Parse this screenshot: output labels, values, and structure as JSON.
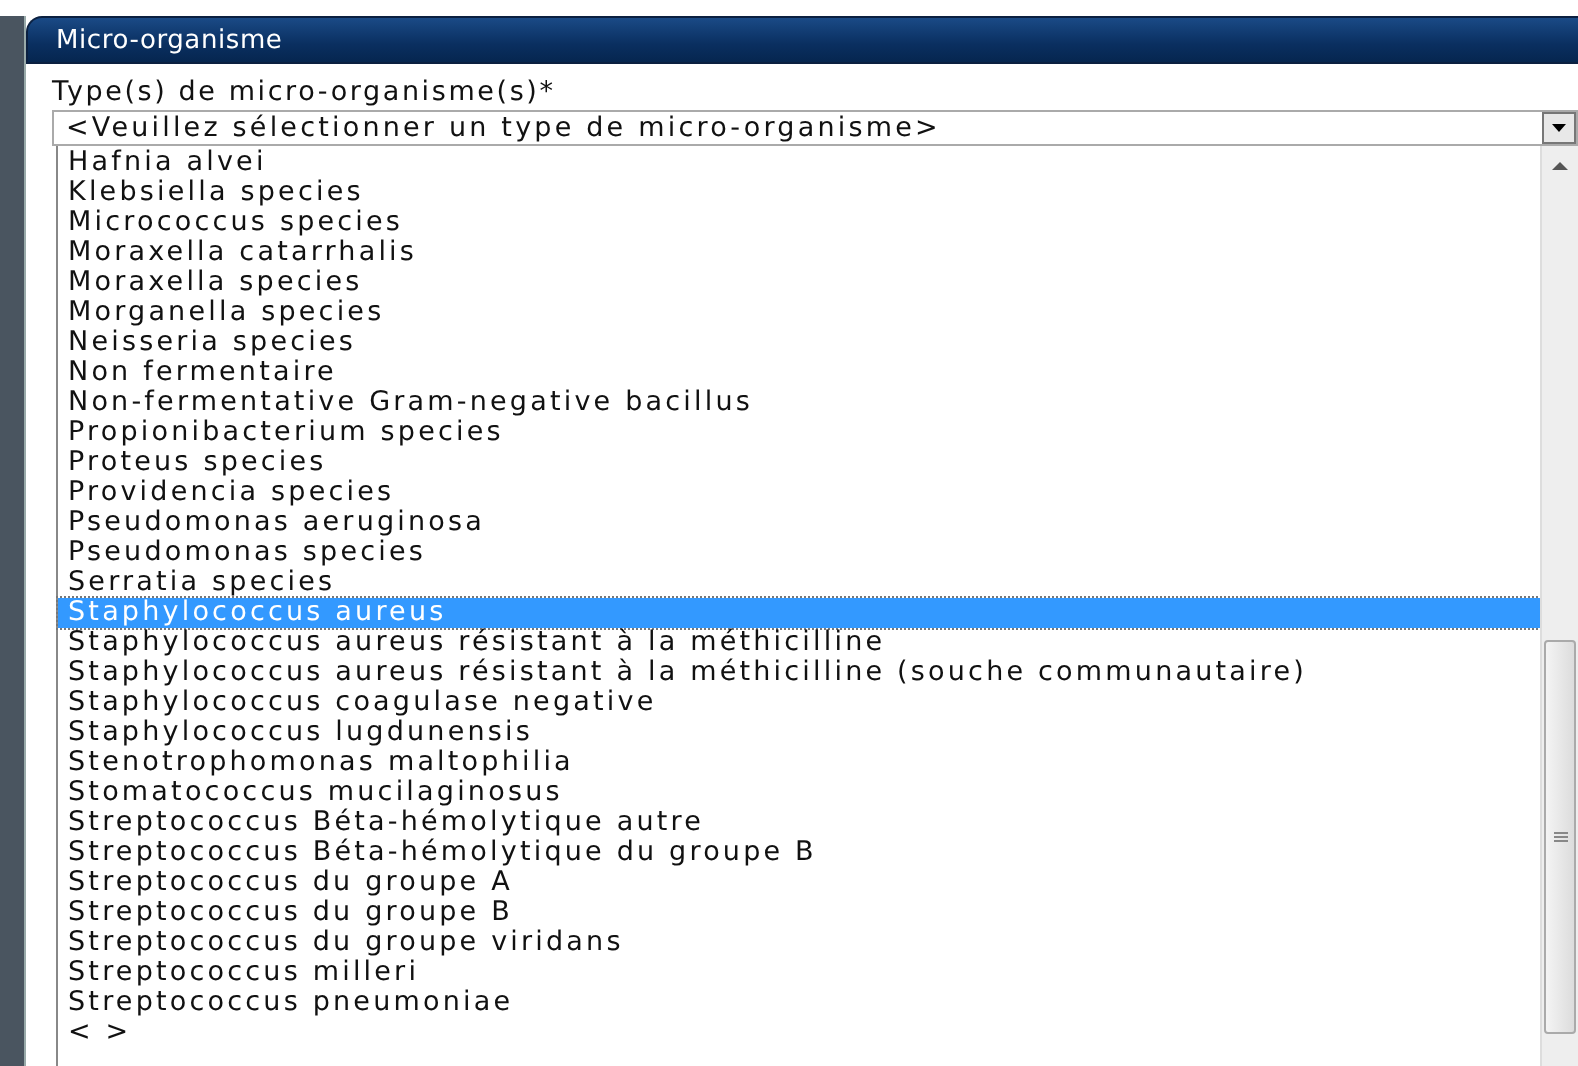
{
  "window": {
    "title": "Micro-organisme"
  },
  "field": {
    "label": "Type(s) de micro-organisme(s)*",
    "value": "<Veuillez sélectionner un type de micro-organisme>"
  },
  "options": [
    {
      "label": "Hafnia alvei",
      "selected": false
    },
    {
      "label": "Klebsiella species",
      "selected": false
    },
    {
      "label": "Micrococcus species",
      "selected": false
    },
    {
      "label": "Moraxella catarrhalis",
      "selected": false
    },
    {
      "label": "Moraxella species",
      "selected": false
    },
    {
      "label": "Morganella species",
      "selected": false
    },
    {
      "label": "Neisseria species",
      "selected": false
    },
    {
      "label": "Non fermentaire",
      "selected": false
    },
    {
      "label": "Non-fermentative Gram-negative bacillus",
      "selected": false
    },
    {
      "label": "Propionibacterium species",
      "selected": false
    },
    {
      "label": "Proteus species",
      "selected": false
    },
    {
      "label": "Providencia species",
      "selected": false
    },
    {
      "label": "Pseudomonas aeruginosa",
      "selected": false
    },
    {
      "label": "Pseudomonas species",
      "selected": false
    },
    {
      "label": "Serratia species",
      "selected": false
    },
    {
      "label": "Staphylococcus aureus",
      "selected": true
    },
    {
      "label": "Staphylococcus aureus résistant à la méthicilline",
      "selected": false
    },
    {
      "label": "Staphylococcus aureus résistant à la méthicilline (souche communautaire)",
      "selected": false
    },
    {
      "label": "Staphylococcus coagulase negative",
      "selected": false
    },
    {
      "label": "Staphylococcus lugdunensis",
      "selected": false
    },
    {
      "label": "Stenotrophomonas maltophilia",
      "selected": false
    },
    {
      "label": "Stomatococcus mucilaginosus",
      "selected": false
    },
    {
      "label": "Streptococcus Béta-hémolytique autre",
      "selected": false
    },
    {
      "label": "Streptococcus Béta-hémolytique du groupe B",
      "selected": false
    },
    {
      "label": "Streptococcus du groupe A",
      "selected": false
    },
    {
      "label": "Streptococcus du groupe B",
      "selected": false
    },
    {
      "label": "Streptococcus du groupe viridans",
      "selected": false
    },
    {
      "label": "Streptococcus milleri",
      "selected": false
    },
    {
      "label": "Streptococcus pneumoniae",
      "selected": false
    },
    {
      "label": "<  >",
      "selected": false
    }
  ]
}
